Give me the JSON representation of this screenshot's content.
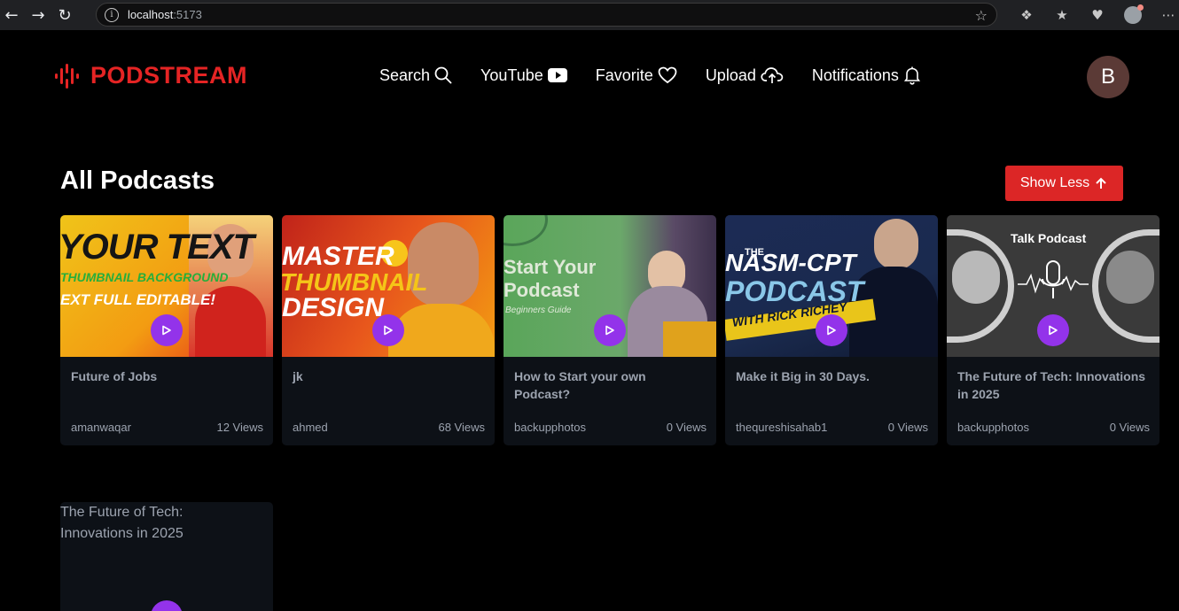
{
  "browser": {
    "url_host": "localhost",
    "url_port": ":5173"
  },
  "brand": {
    "name": "PODSTREAM"
  },
  "nav": {
    "search": "Search",
    "youtube": "YouTube",
    "favorite": "Favorite",
    "upload": "Upload",
    "notifications": "Notifications"
  },
  "user": {
    "initial": "B"
  },
  "section": {
    "title": "All Podcasts",
    "toggle_label": "Show Less"
  },
  "podcasts": [
    {
      "title": "Future of Jobs",
      "author": "amanwaqar",
      "views": "12 Views",
      "thumb_lines": [
        "YOUR TEXT",
        "THUMBNAIL BACKGROUND",
        "EXT FULL EDITABLE!"
      ]
    },
    {
      "title": "jk",
      "author": "ahmed",
      "views": "68 Views",
      "thumb_lines": [
        "MASTER",
        "THUMBNAIL",
        "DESIGN"
      ]
    },
    {
      "title": "How to Start your own Podcast?",
      "author": "backupphotos",
      "views": "0 Views",
      "thumb_lines": [
        "Start Your",
        "Podcast",
        "Beginners Guide"
      ]
    },
    {
      "title": "Make it Big in 30 Days.",
      "author": "thequreshisahab1",
      "views": "0 Views",
      "thumb_lines": [
        "THE",
        "NASM-CPT",
        "PODCAST",
        "WITH RICK RICHEY"
      ]
    },
    {
      "title": "The Future of Tech: Innovations in 2025",
      "author": "backupphotos",
      "views": "0 Views",
      "thumb_lines": [
        "Talk Podcast"
      ]
    }
  ],
  "second_row": {
    "image_alt": "The Future of Tech: Innovations in 2025"
  },
  "colors": {
    "brand_red": "#e52424",
    "button_red": "#dc2626",
    "play_purple": "#9333ea",
    "card_bg": "#0d1117"
  }
}
